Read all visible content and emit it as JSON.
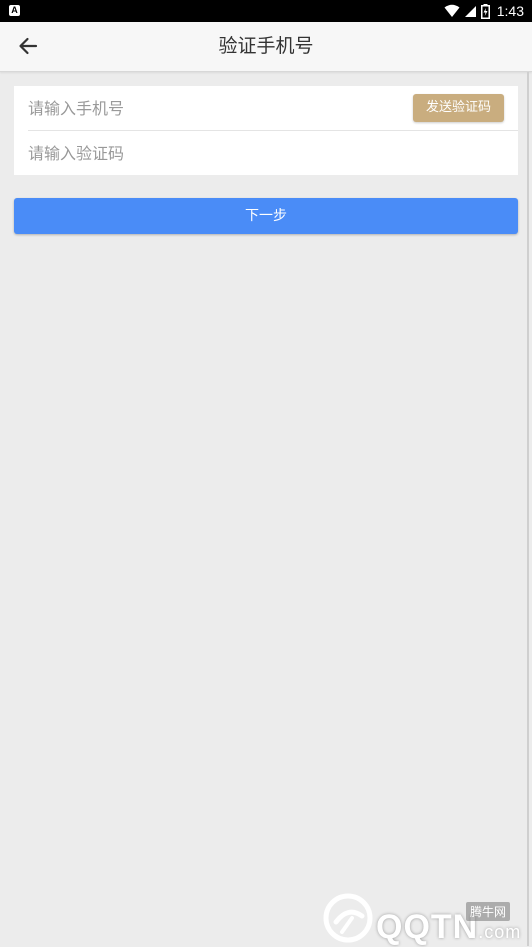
{
  "status_bar": {
    "time": "1:43",
    "app_icon_letter": "A"
  },
  "header": {
    "title": "验证手机号"
  },
  "form": {
    "phone_placeholder": "请输入手机号",
    "code_placeholder": "请输入验证码",
    "send_code_label": "发送验证码"
  },
  "actions": {
    "next_label": "下一步"
  },
  "watermark": {
    "brand": "腾牛网",
    "site_main": "QQTN",
    "site_suffix": ".com"
  },
  "colors": {
    "send_code_button": "#c9ad7f",
    "next_button": "#4a8cf7",
    "background": "#ececec"
  }
}
